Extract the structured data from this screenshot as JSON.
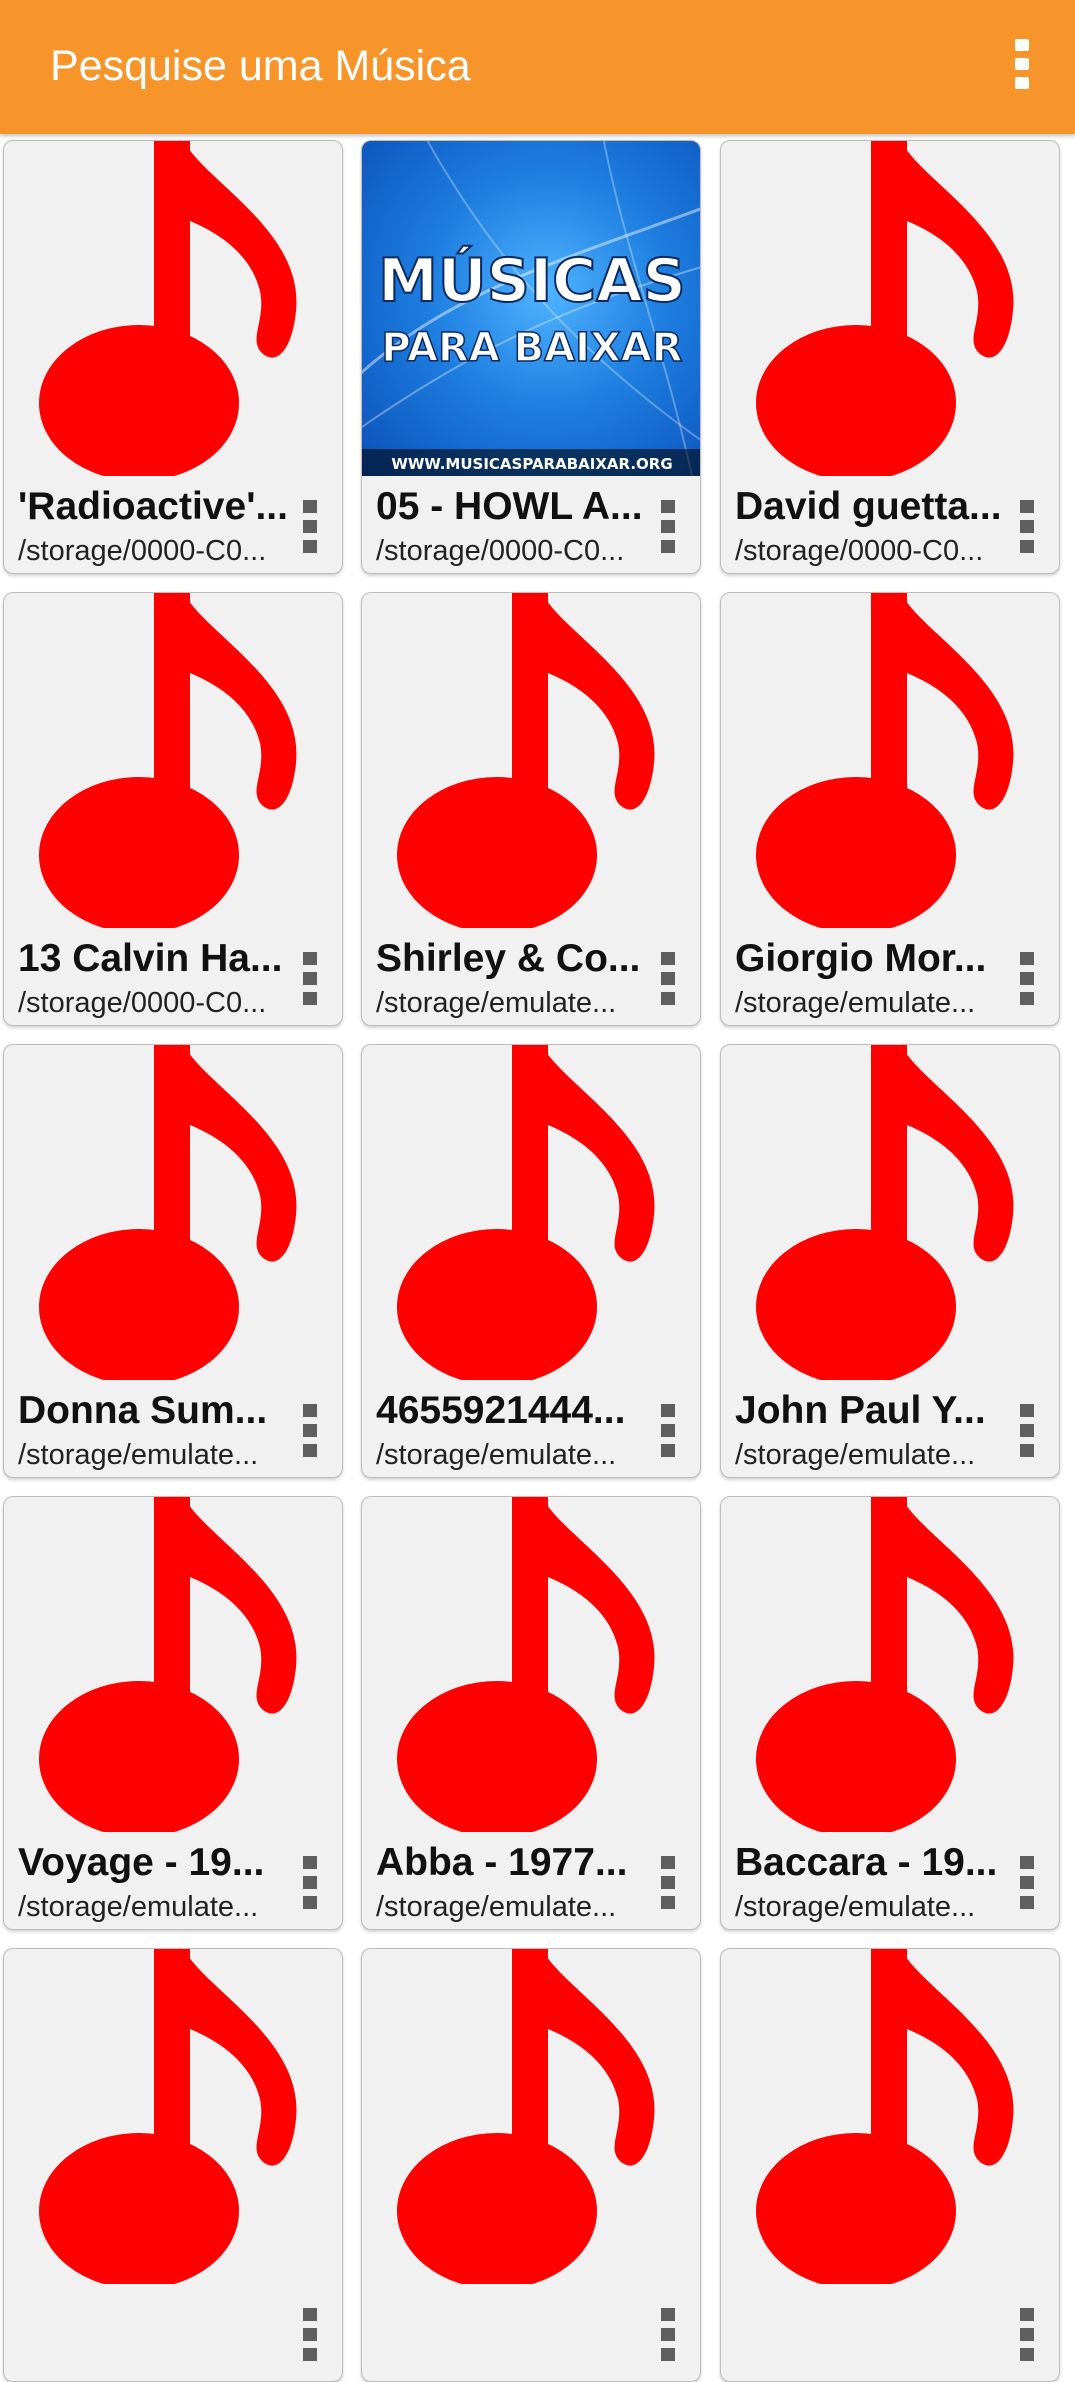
{
  "appbar": {
    "title": "Pesquise uma Música",
    "menu_icon": "more-vert-icon",
    "background": "#F7942A"
  },
  "thumbnail_colors": {
    "note": "#FF0000",
    "card_background": "#F1F1F1"
  },
  "songs": [
    {
      "title": "'Radioactive'...",
      "path": "/storage/0000-C0...",
      "thumb": "music-note-icon"
    },
    {
      "title": "05 - HOWL A...",
      "path": "/storage/0000-C0...",
      "thumb": "album-art",
      "art": {
        "line1": "MÚSICAS",
        "line2": "PARA BAIXAR",
        "url": "WWW.MUSICASPARABAIXAR.ORG"
      }
    },
    {
      "title": "David guetta...",
      "path": "/storage/0000-C0...",
      "thumb": "music-note-icon"
    },
    {
      "title": "13 Calvin Ha...",
      "path": "/storage/0000-C0...",
      "thumb": "music-note-icon"
    },
    {
      "title": "Shirley & Co...",
      "path": "/storage/emulate...",
      "thumb": "music-note-icon"
    },
    {
      "title": "Giorgio Mor...",
      "path": "/storage/emulate...",
      "thumb": "music-note-icon"
    },
    {
      "title": "Donna Sum...",
      "path": "/storage/emulate...",
      "thumb": "music-note-icon"
    },
    {
      "title": "4655921444...",
      "path": "/storage/emulate...",
      "thumb": "music-note-icon"
    },
    {
      "title": "John Paul Y...",
      "path": "/storage/emulate...",
      "thumb": "music-note-icon"
    },
    {
      "title": "Voyage - 19...",
      "path": "/storage/emulate...",
      "thumb": "music-note-icon"
    },
    {
      "title": "Abba - 1977...",
      "path": "/storage/emulate...",
      "thumb": "music-note-icon"
    },
    {
      "title": "Baccara - 19...",
      "path": "/storage/emulate...",
      "thumb": "music-note-icon"
    },
    {
      "title": "",
      "path": "",
      "thumb": "music-note-icon"
    },
    {
      "title": "",
      "path": "",
      "thumb": "music-note-icon"
    },
    {
      "title": "",
      "path": "",
      "thumb": "music-note-icon"
    }
  ]
}
